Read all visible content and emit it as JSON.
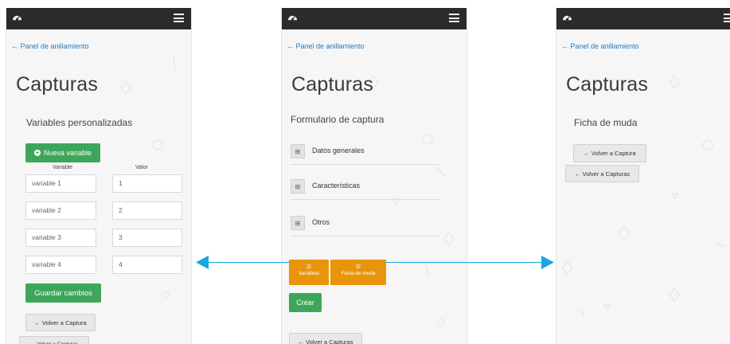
{
  "common": {
    "back_link": "← Panel de anillamiento",
    "page_title": "Capturas"
  },
  "left": {
    "section_title": "Variables personalizadas",
    "new_variable_label": "Nueva variable",
    "col_variable": "Variable",
    "col_value": "Valor",
    "rows": [
      {
        "variable": "variable 1",
        "value": "1"
      },
      {
        "variable": "variable 2",
        "value": "2"
      },
      {
        "variable": "variable 3",
        "value": "3"
      },
      {
        "variable": "variable 4",
        "value": "4"
      }
    ],
    "save_label": "Guardar cambios",
    "back_capture_label": "← Volver a Captura",
    "back_captures_label": "← Volver a Capturas"
  },
  "middle": {
    "section_title": "Formulario de captura",
    "sections": [
      "Datos generales",
      "Características",
      "Otros"
    ],
    "variables_label": "Variables",
    "molt_label": "Ficha de muda",
    "create_label": "Crear",
    "back_captures_label": "← Volver a Capturas"
  },
  "right": {
    "section_title": "Ficha de muda",
    "back_capture_label": "← Volver a Captura",
    "back_captures_label": "← Volver a Capturas"
  },
  "colors": {
    "topbar": "#2b2b2b",
    "link": "#2a79b8",
    "green": "#3ea65a",
    "orange": "#e8950c",
    "arrow": "#1aa6e0"
  },
  "icons": [
    "dashboard-icon",
    "hamburger-menu-icon",
    "plus-circle-icon",
    "plus-square-icon",
    "list-icon",
    "arrow-left-icon",
    "arrow-right-icon"
  ]
}
